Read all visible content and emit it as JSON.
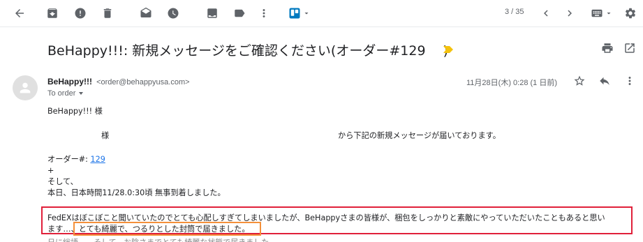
{
  "toolbar": {
    "icons": [
      "back-arrow-icon",
      "archive-icon",
      "report-spam-icon",
      "delete-icon",
      "mark-unread-icon",
      "snooze-icon",
      "move-to-icon",
      "label-icon",
      "more-vert-icon",
      "trello-icon",
      "dropdown-icon"
    ],
    "pager": "3 / 35"
  },
  "subject": {
    "text": "BeHappy!!!: 新規メッセージをご確認ください(オーダー#129　 )",
    "label_color": "#f4c20d"
  },
  "sender": {
    "name": "BeHappy!!!",
    "email": "<order@behappyusa.com>",
    "recipient": "To order",
    "date": "11月28日(木) 0:28 (1 日前)"
  },
  "body": {
    "greeting": "BeHappy!!! 様",
    "line_sama": "様",
    "line_received": "から下記の新規メッセージが届いております。",
    "order_label": "オーダー#: ",
    "order_number": "129",
    "plus": "+",
    "soshite": "そして、",
    "arrived": "本日、日本時間11/28.0:30頃 無事到着しました。",
    "feedback_line1": "FedEXはぼこぼこと聞いていたのでとても心配しすぎてしまいましたが、BeHappyさまの皆様が、梱包をしっかりと素敵にやっていただいたこともあると思い",
    "feedback_line2_prefix": "ます…、",
    "feedback_highlight": "とても綺麗で、つるりとした封筒で届きました。",
    "cutoff_line": "日に総語…　そして、お陰さまでとても綺麗な状態で届きました、　　　　　　　　　　　　　　　　　　　　　　　　　　　　　　　　　　　　　　　"
  },
  "colors": {
    "highlight_box": "#e0203a",
    "emphasis_box": "#f4903a",
    "link": "#1a73e8"
  }
}
